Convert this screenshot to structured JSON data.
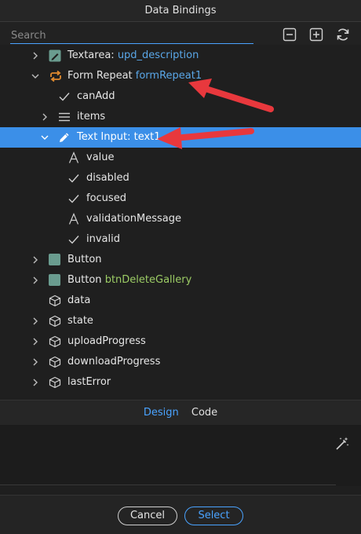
{
  "window": {
    "title": "Data Bindings"
  },
  "search": {
    "placeholder": "Search"
  },
  "toolbar": {
    "collapse_icon": "minus-square-icon",
    "expand_icon": "plus-square-icon",
    "refresh_icon": "refresh-icon"
  },
  "tree": [
    {
      "prefix": "Textarea:",
      "name": "upd_description",
      "icon": "textarea-icon",
      "state": "collapsed"
    },
    {
      "prefix": "Form Repeat",
      "name": "formRepeat1",
      "icon": "repeat-icon",
      "state": "expanded"
    },
    {
      "prefix": "canAdd",
      "icon": "check-icon"
    },
    {
      "prefix": "items",
      "icon": "list-icon",
      "state": "collapsed"
    },
    {
      "prefix": "Text Input: text1",
      "icon": "pencil-icon",
      "state": "expanded",
      "selected": true
    },
    {
      "prefix": "value",
      "icon": "text-a-icon"
    },
    {
      "prefix": "disabled",
      "icon": "check-icon"
    },
    {
      "prefix": "focused",
      "icon": "check-icon"
    },
    {
      "prefix": "validationMessage",
      "icon": "text-a-icon"
    },
    {
      "prefix": "invalid",
      "icon": "check-icon"
    },
    {
      "prefix": "Button",
      "icon": "button-square-icon",
      "state": "collapsed"
    },
    {
      "prefix": "Button",
      "name": "btnDeleteGallery",
      "icon": "button-square-icon",
      "state": "collapsed"
    },
    {
      "prefix": "data",
      "icon": "cube-icon"
    },
    {
      "prefix": "state",
      "icon": "cube-icon",
      "state": "collapsed"
    },
    {
      "prefix": "uploadProgress",
      "icon": "cube-icon",
      "state": "collapsed"
    },
    {
      "prefix": "downloadProgress",
      "icon": "cube-icon",
      "state": "collapsed"
    },
    {
      "prefix": "lastError",
      "icon": "cube-icon",
      "state": "collapsed"
    }
  ],
  "tabs": {
    "design": "Design",
    "code": "Code"
  },
  "editor": {
    "magic_icon": "magic-wand-icon"
  },
  "buttons": {
    "cancel": "Cancel",
    "select": "Select"
  },
  "colors": {
    "accent": "#4aa3ff",
    "selection": "#3b8fe8",
    "annotation_arrow": "#e8383d",
    "binding_name": "#5aa7e8",
    "binding_name_alt": "#9ccc65"
  }
}
